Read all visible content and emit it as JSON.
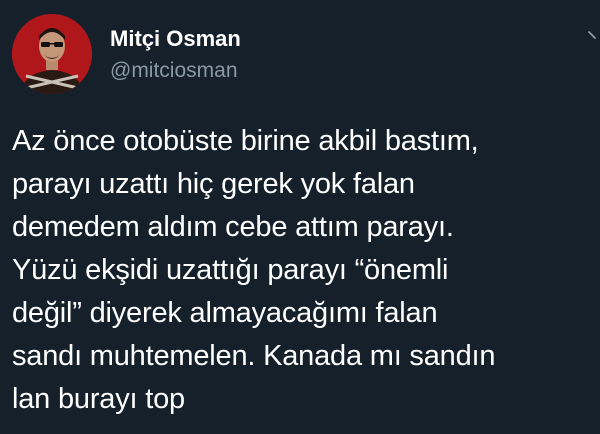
{
  "tweet": {
    "author": {
      "display_name": "Mitçi Osman",
      "handle": "@mitciosman"
    },
    "body_lines": [
      "Az önce otobüste birine akbil bastım,",
      "parayı uzattı hiç gerek yok falan",
      "demedem aldım cebe attım parayı.",
      "Yüzü ekşidi uzattığı parayı “önemli",
      "değil” diyerek almayacağımı falan",
      "sandı muhtemelen. Kanada mı sandın",
      "lan burayı top"
    ],
    "menu_icon": "chevron-down-icon"
  },
  "colors": {
    "background": "#15202b",
    "text": "#ffffff",
    "secondary_text": "#8899a6",
    "avatar_bg": "#b0171b"
  }
}
